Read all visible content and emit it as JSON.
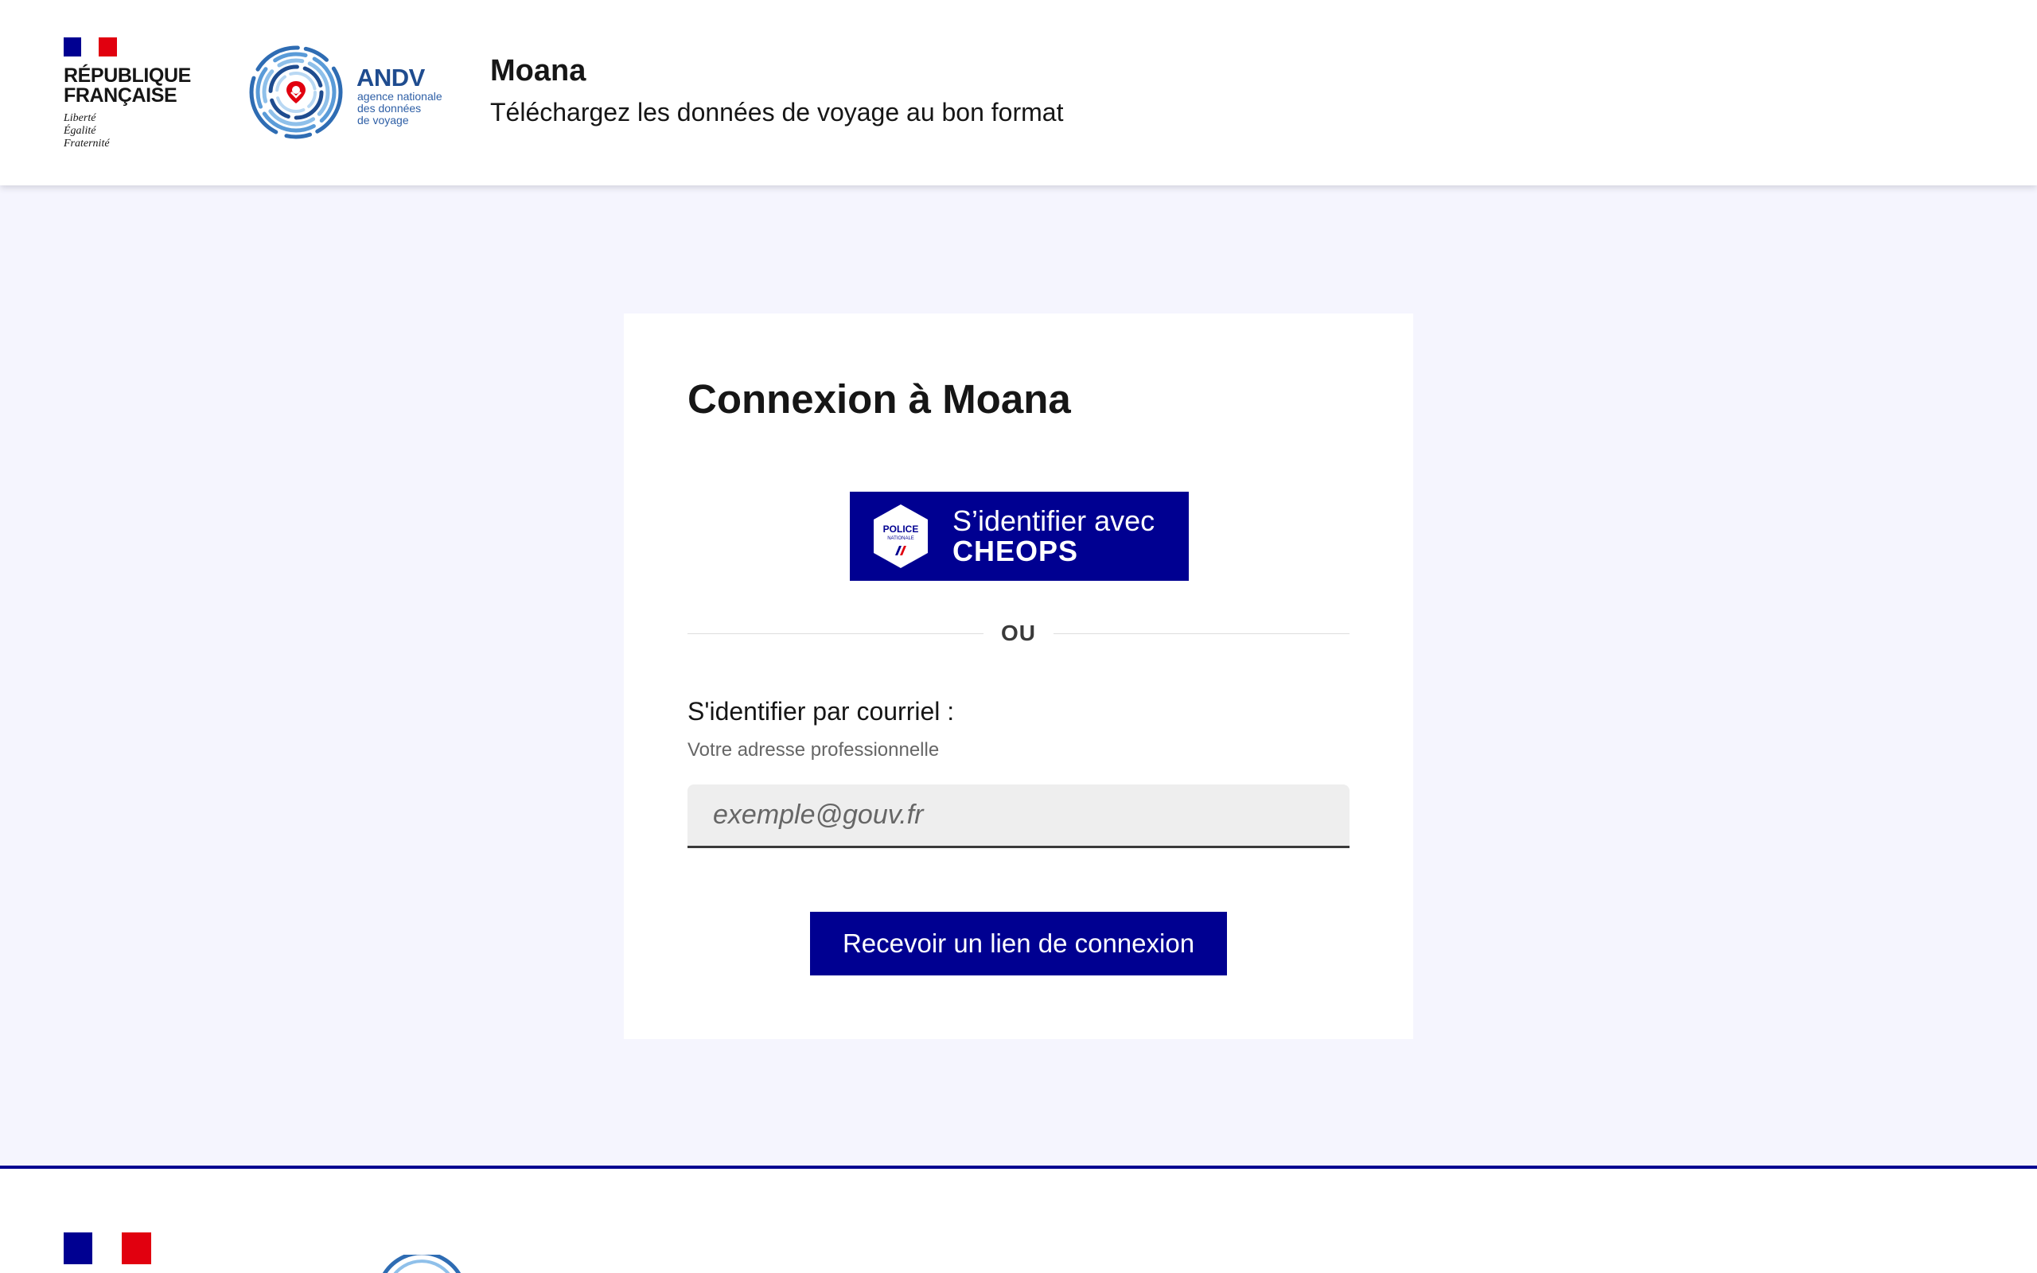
{
  "header": {
    "republic_name_line1": "RÉPUBLIQUE",
    "republic_name_line2": "FRANÇAISE",
    "motto": [
      "Liberté",
      "Égalité",
      "Fraternité"
    ],
    "partner_logo": {
      "acronym": "ANDV",
      "subtitle": [
        "agence nationale",
        "des données",
        "de voyage"
      ]
    },
    "service_title": "Moana",
    "service_tagline": "Téléchargez les données de voyage au bon format"
  },
  "login": {
    "title": "Connexion à Moana",
    "cheops_button": {
      "line1": "S’identifier avec",
      "line2": "CHEOPS",
      "badge_text": [
        "POLICE",
        "NATIONALE"
      ]
    },
    "separator": "OU",
    "email_label": "S'identifier par courriel :",
    "email_hint": "Votre adresse professionnelle",
    "email_value": "",
    "email_placeholder": "exemple@gouv.fr",
    "submit_label": "Recevoir un lien de connexion"
  },
  "colors": {
    "brand_blue": "#000091",
    "marianne_red": "#e1000f",
    "page_background": "#f5f5fe",
    "andv_blue": "#1f4c8f",
    "andv_red": "#e1000f"
  }
}
